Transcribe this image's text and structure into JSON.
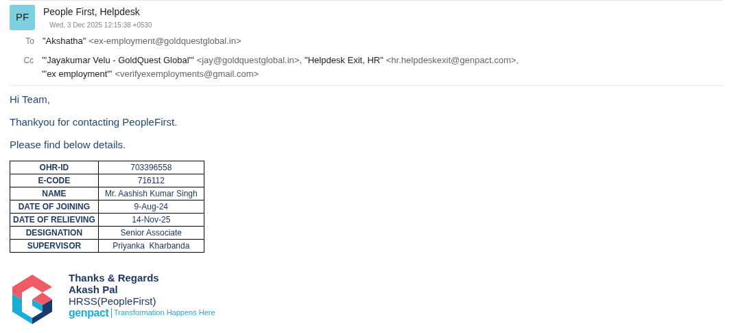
{
  "header": {
    "avatar": "PF",
    "sender": "People First, Helpdesk",
    "date": "Wed, 3 Dec 2025 12:15:38 +0530",
    "to": {
      "label": "To",
      "recipients": [
        {
          "name": "\"Akshatha\"",
          "address": "<ex-employment@goldquestglobal.in>"
        }
      ]
    },
    "cc": {
      "label": "Cc",
      "recipients": [
        {
          "name": "\"'Jayakumar Velu - GoldQuest Global'\"",
          "address": "<jay@goldquestglobal.in>",
          "separator": ","
        },
        {
          "name": "\"Helpdesk Exit, HR\"",
          "address": "<hr.helpdeskexit@genpact.com>",
          "separator": ","
        },
        {
          "name": "\"'ex employment'\"",
          "address": "<verifyexemployments@gmail.com>"
        }
      ]
    }
  },
  "body": {
    "paragraphs": [
      "Hi Team,",
      "Thankyou for contacting PeopleFirst.",
      "Please find below details."
    ],
    "table": [
      {
        "label": "OHR-ID",
        "value": "703396558"
      },
      {
        "label": "E-CODE",
        "value": "716112"
      },
      {
        "label": "NAME",
        "value": "Mr. Aashish Kumar Singh"
      },
      {
        "label": "DATE OF JOINING",
        "value": "9-Aug-24"
      },
      {
        "label": "DATE OF RELIEVING",
        "value": "14-Nov-25"
      },
      {
        "label": "DESIGNATION",
        "value": "Senior Associate"
      },
      {
        "label": "SUPERVISOR",
        "value": "Priyanka  Kharbanda"
      }
    ]
  },
  "signature": {
    "closing": "Thanks & Regards",
    "name": "Akash Pal",
    "team": "HRSS(PeopleFirst)",
    "brand": "genpact",
    "tagline": "Transformation Happens Here"
  }
}
